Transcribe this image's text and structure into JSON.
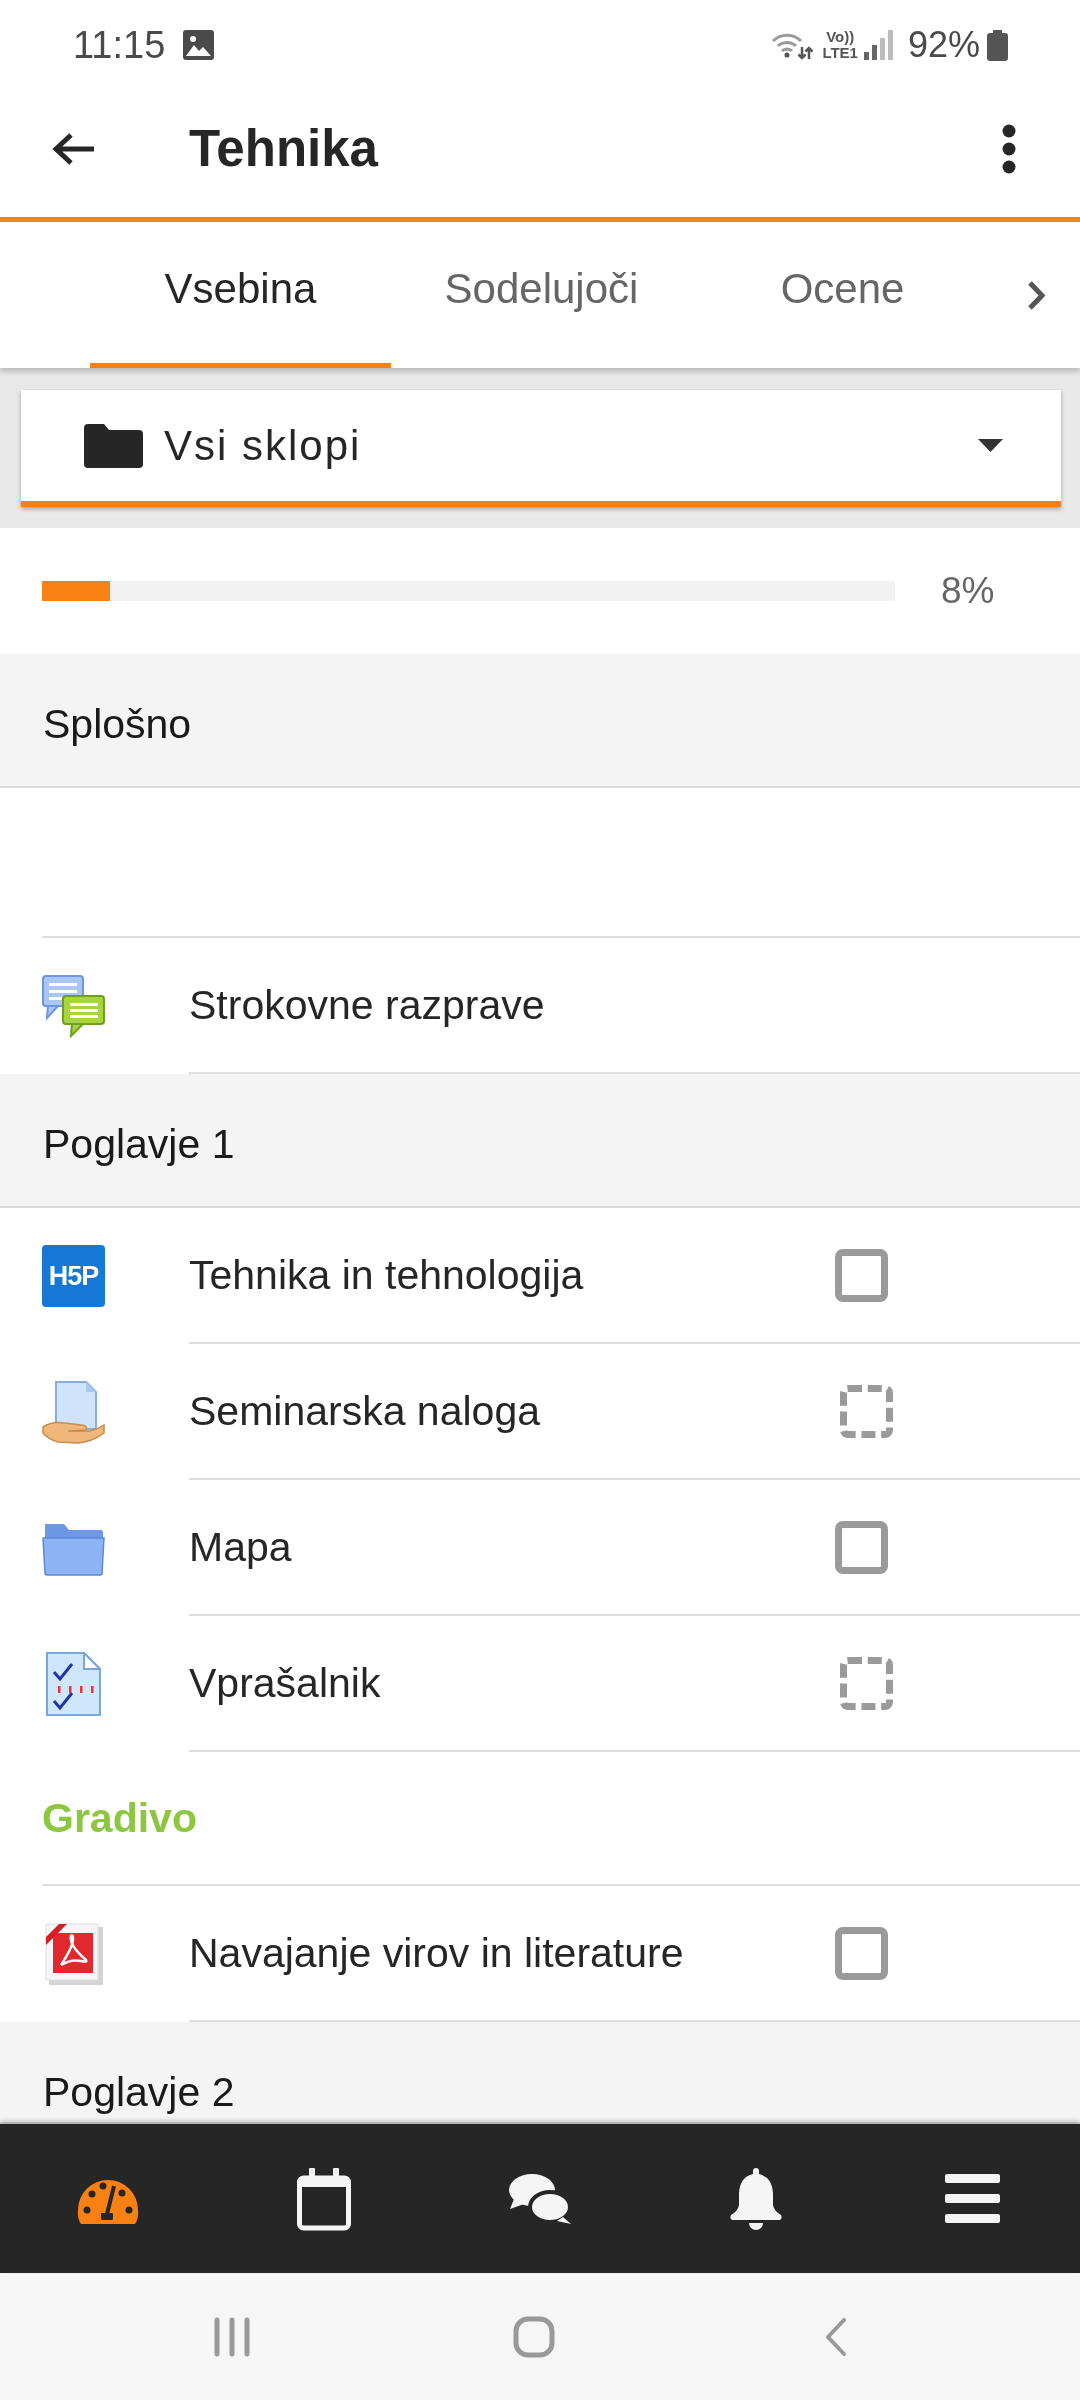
{
  "status_bar": {
    "time": "11:15",
    "network_top": "Vo))",
    "network_bottom": "LTE1",
    "battery": "92%"
  },
  "app_bar": {
    "title": "Tehnika"
  },
  "tabs": [
    {
      "label": "Vsebina",
      "selected": true
    },
    {
      "label": "Sodelujoči",
      "selected": false
    },
    {
      "label": "Ocene",
      "selected": false
    }
  ],
  "section_picker": {
    "value": "Vsi sklopi"
  },
  "progress": {
    "level": 0.08,
    "reading": "8%"
  },
  "sections": [
    {
      "title": "Splošno",
      "items": [
        {
          "kind": "label"
        },
        {
          "kind": "forum",
          "name": "Strokovne razprave"
        }
      ]
    },
    {
      "title": "Poglavje 1",
      "items": [
        {
          "kind": "h5p",
          "logo_text": "H5P",
          "name": "Tehnika in tehnologija",
          "completion": {
            "kind": "solid",
            "checked": false
          }
        },
        {
          "kind": "assignment",
          "name": "Seminarska naloga",
          "completion": {
            "kind": "dashed",
            "checked": false
          }
        },
        {
          "kind": "folder",
          "name": "Mapa",
          "completion": {
            "kind": "solid",
            "checked": false
          }
        },
        {
          "kind": "quiz",
          "name": "Vprašalnik",
          "completion": {
            "kind": "dashed",
            "checked": false
          }
        },
        {
          "kind": "label",
          "text": "Gradivo"
        },
        {
          "kind": "pdf",
          "name": "Navajanje virov in literature",
          "completion": {
            "kind": "solid",
            "checked": false
          }
        }
      ]
    },
    {
      "title": "Poglavje 2"
    }
  ],
  "bottom_nav": [
    {
      "kind": "dashboard",
      "selected": true
    },
    {
      "kind": "calendar",
      "selected": false
    },
    {
      "kind": "messages",
      "selected": false
    },
    {
      "kind": "notifications",
      "selected": false
    },
    {
      "kind": "menu",
      "selected": false
    }
  ]
}
